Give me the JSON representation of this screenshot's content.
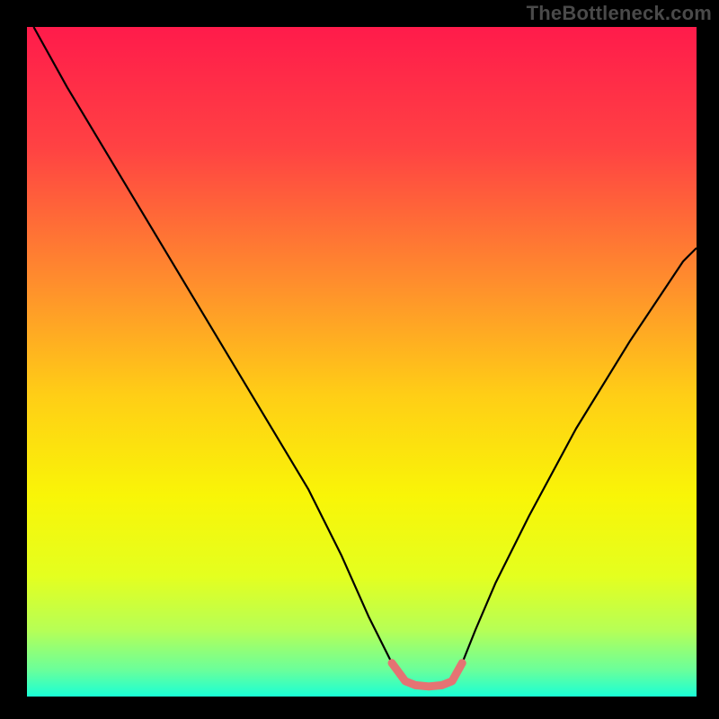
{
  "watermark": "TheBottleneck.com",
  "chart_data": {
    "type": "line",
    "title": "",
    "xlabel": "",
    "ylabel": "",
    "xlim": [
      0,
      100
    ],
    "ylim": [
      0,
      100
    ],
    "grid": false,
    "background_gradient": {
      "stops": [
        {
          "offset": 0.0,
          "color": "#ff1b4b"
        },
        {
          "offset": 0.18,
          "color": "#ff4243"
        },
        {
          "offset": 0.38,
          "color": "#ff8d2d"
        },
        {
          "offset": 0.55,
          "color": "#ffce16"
        },
        {
          "offset": 0.7,
          "color": "#f9f507"
        },
        {
          "offset": 0.82,
          "color": "#e4ff1f"
        },
        {
          "offset": 0.9,
          "color": "#b7ff55"
        },
        {
          "offset": 0.96,
          "color": "#6bff9a"
        },
        {
          "offset": 1.0,
          "color": "#19ffd6"
        }
      ]
    },
    "series": [
      {
        "name": "bottleneck-curve",
        "color": "#000000",
        "stroke_width": 2.2,
        "x": [
          1,
          6,
          12,
          18,
          24,
          30,
          36,
          42,
          47,
          51,
          54.5,
          56.5,
          58,
          60,
          62,
          63.5,
          65,
          67,
          70,
          75,
          82,
          90,
          98,
          100
        ],
        "y": [
          100,
          91,
          81,
          71,
          61,
          51,
          41,
          31,
          21,
          12,
          5,
          2.3,
          1.7,
          1.5,
          1.7,
          2.3,
          5,
          10,
          17,
          27,
          40,
          53,
          65,
          67
        ]
      },
      {
        "name": "highlight-band",
        "color": "#e57373",
        "stroke_width": 9,
        "linecap": "round",
        "x": [
          54.5,
          56.5,
          58,
          60,
          62,
          63.5,
          65
        ],
        "y": [
          5,
          2.3,
          1.7,
          1.5,
          1.7,
          2.3,
          5
        ]
      }
    ]
  }
}
